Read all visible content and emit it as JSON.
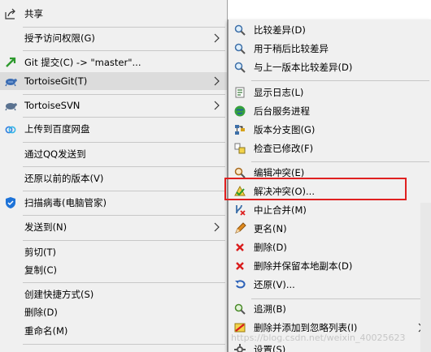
{
  "left_menu": {
    "items": [
      {
        "label": "共享",
        "icon": "share-icon"
      },
      {
        "label": "授予访问权限(G)",
        "submenu": true
      },
      {
        "label": "Git 提交(C) -> \"master\"...",
        "icon": "git-commit-icon"
      },
      {
        "label": "TortoiseGit(T)",
        "icon": "tortoisegit-icon",
        "submenu": true,
        "highlighted": true
      },
      {
        "label": "TortoiseSVN",
        "icon": "tortoisesvn-icon",
        "submenu": true
      },
      {
        "label": "上传到百度网盘",
        "icon": "baidu-cloud-icon"
      },
      {
        "label": "通过QQ发送到"
      },
      {
        "label": "还原以前的版本(V)"
      },
      {
        "label": "扫描病毒(电脑管家)",
        "icon": "shield-icon"
      },
      {
        "label": "发送到(N)",
        "submenu": true
      },
      {
        "label": "剪切(T)"
      },
      {
        "label": "复制(C)"
      },
      {
        "label": "创建快捷方式(S)"
      },
      {
        "label": "删除(D)"
      },
      {
        "label": "重命名(M)"
      }
    ]
  },
  "right_menu": {
    "items": [
      {
        "label": "比较差异(D)",
        "icon": "diff-icon"
      },
      {
        "label": "用于稍后比较差异",
        "icon": "diff-later-icon"
      },
      {
        "label": "与上一版本比较差异(D)",
        "icon": "diff-previous-icon"
      },
      {
        "label": "显示日志(L)",
        "icon": "log-icon"
      },
      {
        "label": "后台服务进程",
        "icon": "daemon-icon"
      },
      {
        "label": "版本分支图(G)",
        "icon": "revision-graph-icon"
      },
      {
        "label": "检查已修改(F)",
        "icon": "check-modifications-icon"
      },
      {
        "label": "编辑冲突(E)",
        "icon": "edit-conflict-icon"
      },
      {
        "label": "解决冲突(O)...",
        "icon": "resolve-conflict-icon"
      },
      {
        "label": "中止合并(M)",
        "icon": "abort-merge-icon"
      },
      {
        "label": "更名(N)",
        "icon": "rename-icon"
      },
      {
        "label": "删除(D)",
        "icon": "delete-icon"
      },
      {
        "label": "删除并保留本地副本(D)",
        "icon": "delete-keep-local-icon"
      },
      {
        "label": "还原(V)...",
        "icon": "revert-icon"
      },
      {
        "label": "追溯(B)",
        "icon": "blame-icon"
      },
      {
        "label": "删除并添加到忽略列表(I)",
        "icon": "ignore-icon",
        "submenu": true
      },
      {
        "label": "设置(S)",
        "icon": "settings-icon"
      }
    ]
  },
  "watermark": "https://blog.csdn.net/weixin_40025623",
  "colors": {
    "highlight_border": "#e02020",
    "menu_bg": "#f0f0f0",
    "hover_bg": "#dcdcdc"
  }
}
